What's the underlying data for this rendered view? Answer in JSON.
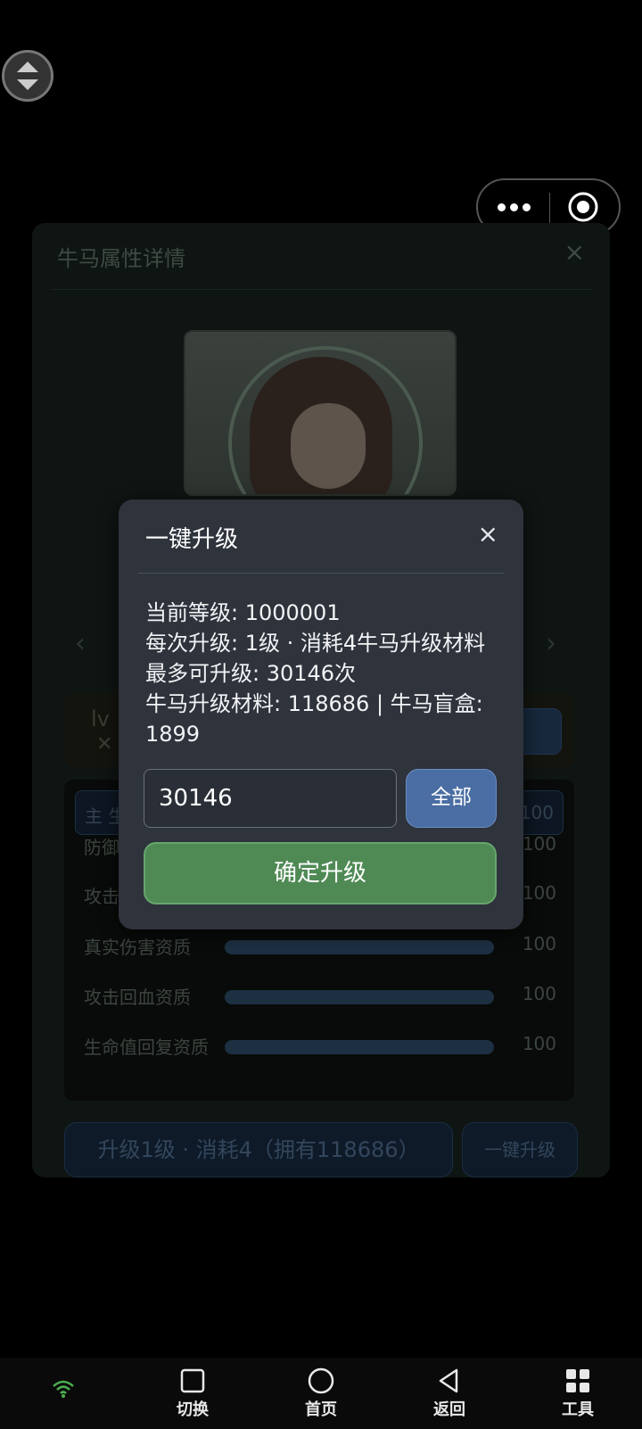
{
  "detail_panel": {
    "title": "牛马属性详情",
    "close_icon": "×",
    "prev_icon": "‹",
    "next_icon": "›",
    "level_prefix": "lv",
    "level_sub": "✕",
    "stat_rows": [
      {
        "name": "防御",
        "value": "100"
      },
      {
        "name": "攻击",
        "value": "100"
      },
      {
        "name": "真实伤害资质",
        "value": "100"
      },
      {
        "name": "攻击回血资质",
        "value": "100"
      },
      {
        "name": "生命值回复资质",
        "value": "100"
      }
    ],
    "main_tag": "主 生",
    "main_value": "100",
    "upgrade_one_label": "升级1级 · 消耗4（拥有118686）",
    "upgrade_all_label": "一键升级"
  },
  "modal": {
    "title": "一键升级",
    "close_icon": "×",
    "current_level": "当前等级: 1000001",
    "per_upgrade": "每次升级: 1级 · 消耗4牛马升级材料",
    "max_upgrade": "最多可升级: 30146次",
    "materials": "牛马升级材料: 118686 | 牛马盲盒: 1899",
    "quantity_value": "30146",
    "all_button": "全部",
    "confirm_button": "确定升级"
  },
  "system_nav": {
    "items": [
      {
        "label": "切换",
        "icon": "square-icon"
      },
      {
        "label": "首页",
        "icon": "circle-icon"
      },
      {
        "label": "返回",
        "icon": "triangle-back-icon"
      },
      {
        "label": "工具",
        "icon": "grid-icon"
      }
    ]
  },
  "colors": {
    "modal_bg": "#2e333c",
    "all_button": "#4a6ea3",
    "confirm_button": "#4f8a55",
    "wifi": "#4caf50"
  }
}
